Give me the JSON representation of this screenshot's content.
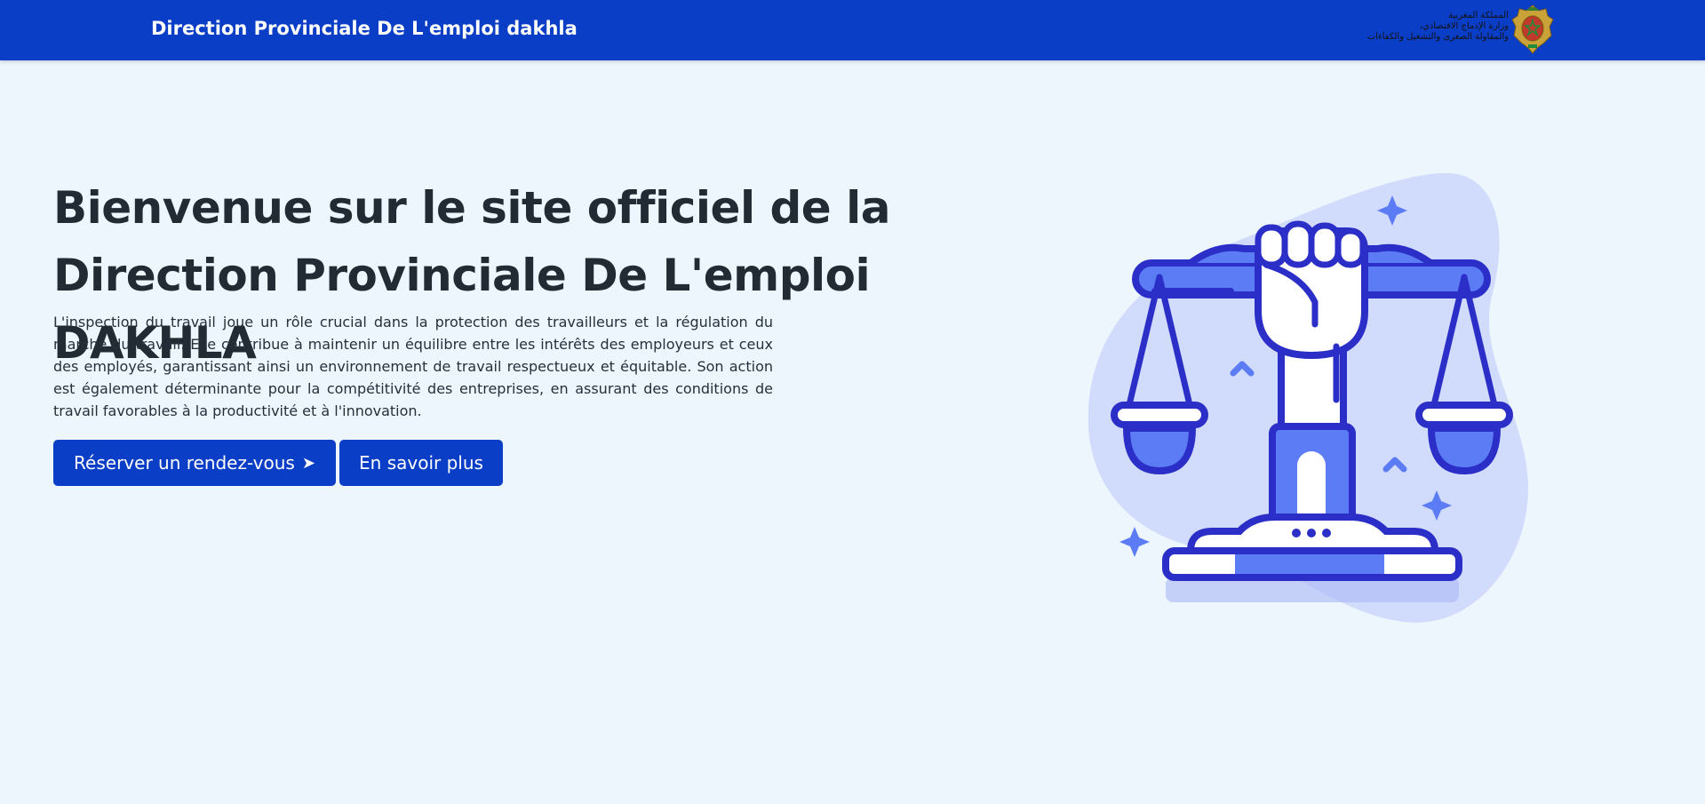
{
  "header": {
    "brand": "Direction Provinciale De L'emploi dakhla",
    "ministry_lines": [
      "المملكة المغربية",
      "وزارة الإدماج الاقتصادي،",
      "والمقاولة الصغرى والتشغيل والكفاءات"
    ],
    "emblem_icon": "coat-of-arms-icon"
  },
  "hero": {
    "title": "Bienvenue sur le site officiel de la Direction Provinciale De L'emploi DAKHLA",
    "description": "L'inspection du travail joue un rôle crucial dans la protection des travailleurs et la régulation du marché du travail. Elle contribue à maintenir un équilibre entre les intérêts des employeurs et ceux des employés, garantissant ainsi un environnement de travail respectueux et équitable. Son action est également déterminante pour la compétitivité des entreprises, en assurant des conditions de travail favorables à la productivité et à l'innovation.",
    "primary_button": "Réserver un rendez-vous",
    "primary_button_icon": "➤",
    "secondary_button": "En savoir plus",
    "illustration_icon": "justice-scale-fist-icon"
  },
  "colors": {
    "header_bg": "#0b3ec6",
    "page_bg": "#eef6fd",
    "accent_dark": "#2b2fc7",
    "accent_mid": "#5b7cf5",
    "accent_light": "#c9d5fb"
  }
}
